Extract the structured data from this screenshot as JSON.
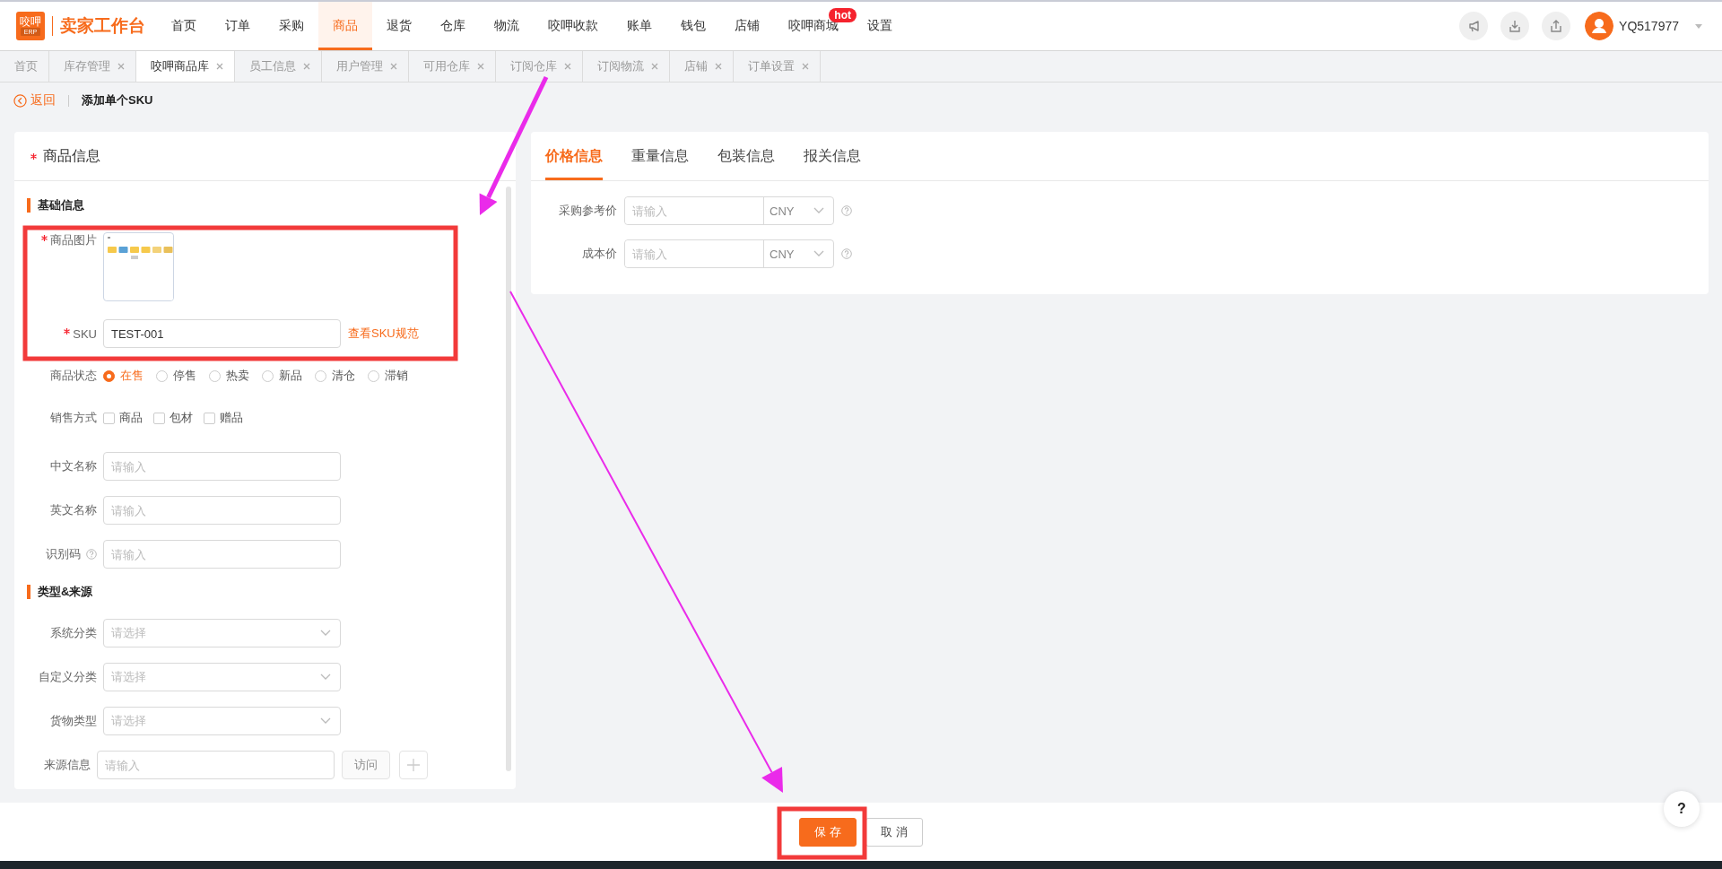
{
  "app": {
    "logo_text": "咬呷",
    "logo_badge": "ERP",
    "title": "卖家工作台"
  },
  "nav": [
    {
      "label": "首页",
      "selected": false
    },
    {
      "label": "订单",
      "selected": false
    },
    {
      "label": "采购",
      "selected": false
    },
    {
      "label": "商品",
      "selected": true
    },
    {
      "label": "退货",
      "selected": false
    },
    {
      "label": "仓库",
      "selected": false
    },
    {
      "label": "物流",
      "selected": false
    },
    {
      "label": "咬呷收款",
      "selected": false
    },
    {
      "label": "账单",
      "selected": false
    },
    {
      "label": "钱包",
      "selected": false
    },
    {
      "label": "店铺",
      "selected": false
    },
    {
      "label": "咬呷商城",
      "selected": false,
      "badge": "hot"
    },
    {
      "label": "设置",
      "selected": false
    }
  ],
  "header_actions": [
    {
      "kind": "announce"
    },
    {
      "kind": "download"
    },
    {
      "kind": "upload"
    }
  ],
  "user": {
    "name": "YQ517977"
  },
  "tabs": [
    {
      "label": "首页",
      "selected": false,
      "closable": false
    },
    {
      "label": "库存管理",
      "selected": false,
      "closable": true
    },
    {
      "label": "咬呷商品库",
      "selected": true,
      "closable": true
    },
    {
      "label": "员工信息",
      "selected": false,
      "closable": true
    },
    {
      "label": "用户管理",
      "selected": false,
      "closable": true
    },
    {
      "label": "可用仓库",
      "selected": false,
      "closable": true
    },
    {
      "label": "订阅仓库",
      "selected": false,
      "closable": true
    },
    {
      "label": "订阅物流",
      "selected": false,
      "closable": true
    },
    {
      "label": "店铺",
      "selected": false,
      "closable": true
    },
    {
      "label": "订单设置",
      "selected": false,
      "closable": true
    }
  ],
  "breadcrumb": {
    "back": "返回",
    "title": "添加单个SKU"
  },
  "product_card": {
    "title": "商品信息",
    "required": true,
    "sections": [
      {
        "title": "基础信息",
        "fields": [
          {
            "label": "商品图片",
            "required": true
          },
          {
            "kind": "text",
            "label": "SKU",
            "required": true,
            "value": "TEST-001",
            "link": "查看SKU规范"
          },
          {
            "kind": "radio",
            "label": "商品状态",
            "options": [
              {
                "label": "在售",
                "selected": true
              },
              {
                "label": "停售",
                "selected": false
              },
              {
                "label": "热卖",
                "selected": false
              },
              {
                "label": "新品",
                "selected": false
              },
              {
                "label": "清仓",
                "selected": false
              },
              {
                "label": "滞销",
                "selected": false
              }
            ]
          },
          {
            "kind": "checkbox",
            "label": "销售方式",
            "options": [
              {
                "label": "商品",
                "checked": false
              },
              {
                "label": "包材",
                "checked": false
              },
              {
                "label": "赠品",
                "checked": false
              }
            ]
          },
          {
            "kind": "input",
            "label": "中文名称",
            "placeholder": "请输入"
          },
          {
            "kind": "input",
            "label": "英文名称",
            "placeholder": "请输入"
          },
          {
            "kind": "input",
            "label": "识别码",
            "placeholder": "请输入",
            "help": true
          }
        ]
      },
      {
        "title": "类型&来源",
        "fields": [
          {
            "kind": "select",
            "label": "系统分类",
            "placeholder": "请选择"
          },
          {
            "kind": "select",
            "label": "自定义分类",
            "placeholder": "请选择"
          },
          {
            "kind": "select",
            "label": "货物类型",
            "placeholder": "请选择"
          },
          {
            "kind": "source",
            "label": "来源信息",
            "placeholder": "请输入",
            "button": {
              "label": "访问",
              "disabled": true
            },
            "add_button": true
          }
        ]
      }
    ]
  },
  "detail_card": {
    "tabs": [
      {
        "label": "价格信息",
        "selected": true
      },
      {
        "label": "重量信息",
        "selected": false
      },
      {
        "label": "包装信息",
        "selected": false
      },
      {
        "label": "报关信息",
        "selected": false
      }
    ],
    "fields": [
      {
        "label": "采购参考价",
        "placeholder": "请输入",
        "currency": "CNY",
        "help": true
      },
      {
        "label": "成本价",
        "placeholder": "请输入",
        "currency": "CNY",
        "help": true
      }
    ]
  },
  "footer": {
    "buttons": [
      {
        "label": "保 存",
        "kind": "primary"
      },
      {
        "label": "取 消",
        "kind": "default"
      }
    ],
    "help": "?"
  },
  "annotations": [
    {
      "kind": "box"
    },
    {
      "kind": "box"
    },
    {
      "kind": "arrow"
    },
    {
      "kind": "arrow"
    }
  ]
}
